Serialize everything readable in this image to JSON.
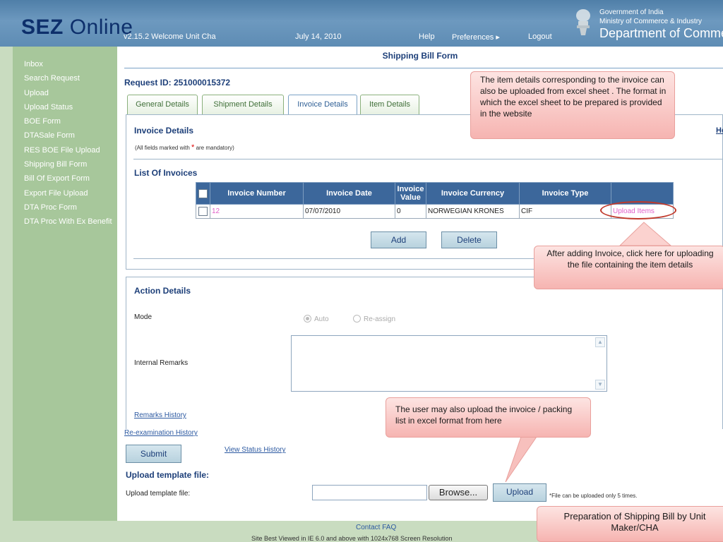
{
  "header": {
    "logo_bold": "SEZ",
    "logo_rest": " Online",
    "version_welcome": "v2.15.2  Welcome Unit Cha",
    "date": "July 14, 2010",
    "help": "Help",
    "preferences": "Preferences ▸",
    "logout": "Logout",
    "gov_line1": "Government of India",
    "gov_line2": "Ministry of Commerce & Industry",
    "gov_line3": "Department of Commerce"
  },
  "sidebar": {
    "items": [
      {
        "label": "Inbox"
      },
      {
        "label": "Search Request"
      },
      {
        "label": "Upload"
      },
      {
        "label": "Upload Status"
      },
      {
        "label": "BOE Form"
      },
      {
        "label": "DTASale Form"
      },
      {
        "label": "RES BOE File Upload"
      },
      {
        "label": "Shipping Bill Form"
      },
      {
        "label": "Bill Of Export Form"
      },
      {
        "label": "Export File Upload"
      },
      {
        "label": "DTA Proc Form"
      },
      {
        "label": "DTA Proc With Ex Benefit"
      }
    ]
  },
  "main": {
    "form_title": "Shipping Bill Form",
    "request_id": "Request ID: 251000015372",
    "tabs": [
      {
        "label": "General Details"
      },
      {
        "label": "Shipment Details"
      },
      {
        "label": "Invoice Details"
      },
      {
        "label": "Item Details"
      }
    ],
    "invoice_details_title": "Invoice Details",
    "help_link": "He",
    "mandatory_prefix": "(All fields marked with",
    "mandatory_star": "*",
    "mandatory_suffix": "are mandatory)",
    "list_title": "List Of Invoices",
    "table": {
      "headers": [
        "Invoice Number",
        "Invoice Date",
        "Invoice Value",
        "Invoice Currency",
        "Invoice Type"
      ],
      "rows": [
        {
          "number": "12",
          "date": "07/07/2010",
          "value": "0",
          "currency": "NORWEGIAN KRONES",
          "type": "CIF",
          "action": "Upload Items"
        }
      ]
    },
    "add_button": "Add",
    "delete_button": "Delete",
    "action_title": "Action Details",
    "mode_label": "Mode",
    "mode_auto": "Auto",
    "mode_reassign": "Re-assign",
    "internal_remarks_label": "Internal Remarks",
    "remarks_history": "Remarks History",
    "reexamination_history": "Re-examination History",
    "submit_button": "Submit",
    "view_status_history": "View Status History",
    "upload_template_title": "Upload template file:",
    "upload_template_label": "Upload template file:",
    "browse_button": "Browse...",
    "upload_button": "Upload",
    "upload_note": "*File can be uploaded only 5 times."
  },
  "footer": {
    "links": "Contact  FAQ",
    "note": "Site Best Viewed in IE 6.0 and above with 1024x768 Screen Resolution"
  },
  "callouts": {
    "c1": "The item details corresponding to the invoice can also be uploaded from excel sheet . The format in which the excel sheet to be prepared is provided in the website",
    "c2": "After adding  Invoice, click here for uploading the  file containing the item details",
    "c3": "The user may also upload the invoice / packing list in excel format from here",
    "c4": "Preparation of Shipping Bill by Unit Maker/CHA"
  },
  "colors": {
    "header_blue": "#5e8cb4",
    "sidebar_green": "#a7c79b",
    "table_header": "#3c679b",
    "callout_pink": "#f6b4b1"
  }
}
